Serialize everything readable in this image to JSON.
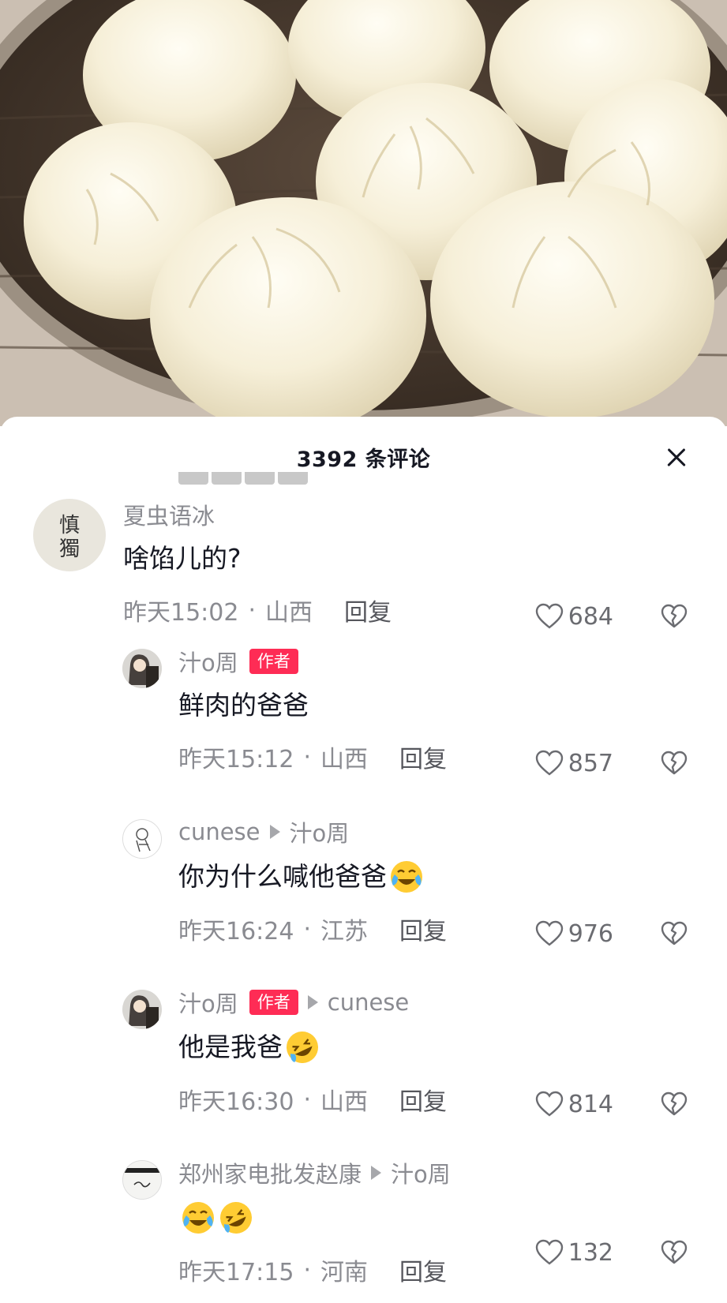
{
  "sheet": {
    "title": "3392 条评论",
    "close_icon": "close-icon"
  },
  "comments": [
    {
      "user": "夏虫语冰",
      "text": "啥馅儿的?",
      "time": "昨天15:02",
      "location": "山西",
      "reply_label": "回复",
      "likes": "684",
      "avatar_text": "慎独"
    },
    {
      "user": "汁o周",
      "badge": "作者",
      "text": "鲜肉的爸爸",
      "time": "昨天15:12",
      "location": "山西",
      "reply_label": "回复",
      "likes": "857"
    },
    {
      "user": "cunese",
      "reply_to": "汁o周",
      "text": "你为什么喊他爸爸",
      "emoji": [
        "crying-laughing"
      ],
      "time": "昨天16:24",
      "location": "江苏",
      "reply_label": "回复",
      "likes": "976"
    },
    {
      "user": "汁o周",
      "badge": "作者",
      "reply_to": "cunese",
      "text": "他是我爸",
      "emoji": [
        "rolling-laughing"
      ],
      "time": "昨天16:30",
      "location": "山西",
      "reply_label": "回复",
      "likes": "814"
    },
    {
      "user": "郑州家电批发赵康",
      "reply_to": "汁o周",
      "text": "",
      "emoji": [
        "crying-laughing",
        "rolling-laughing"
      ],
      "time": "昨天17:15",
      "location": "河南",
      "reply_label": "回复",
      "likes": "132"
    }
  ],
  "meta_separator": "·",
  "colors": {
    "author_badge": "#fe2c55",
    "meta_text": "#8a8b91",
    "primary_text": "#161823"
  },
  "icons": [
    "heart-outline-icon",
    "broken-heart-icon",
    "close-icon",
    "reply-arrow-icon"
  ]
}
